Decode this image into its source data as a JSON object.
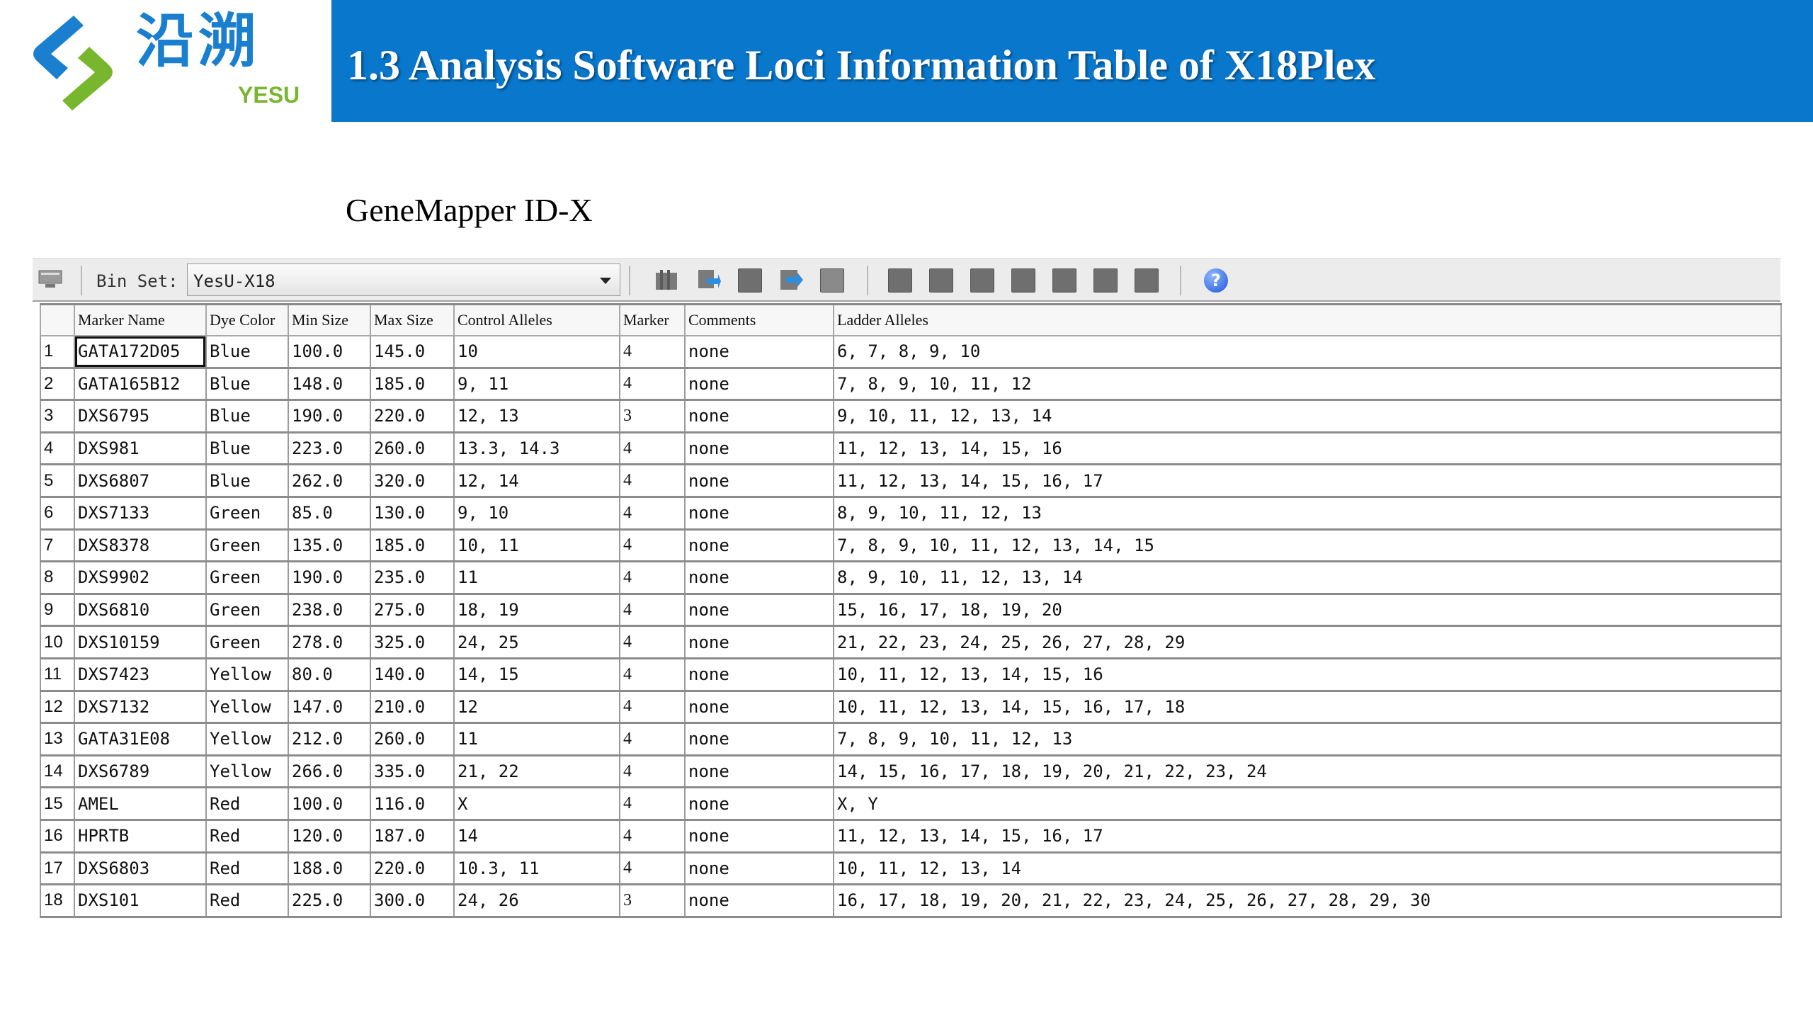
{
  "logo": {
    "cn_text": "沿溯",
    "en_text": "YESU",
    "colors": {
      "blue": "#1a7fce",
      "green": "#78b62e"
    }
  },
  "header": {
    "title": "1.3 Analysis Software Loci Information Table of X18Plex",
    "banner_color": "#0877cc"
  },
  "subtitle": "GeneMapper ID-X",
  "toolbar": {
    "bin_set_label": "Bin Set:",
    "bin_set_value": "YesU-X18",
    "icons": [
      "table-icon",
      "import-icon",
      "grey-square-icon",
      "export-icon",
      "grey-square-icon",
      "grey-square-icon",
      "grey-square-icon",
      "grey-square-icon",
      "grey-square-icon",
      "grey-square-icon",
      "grey-square-icon",
      "grey-square-icon",
      "help-icon"
    ]
  },
  "table": {
    "columns": [
      "",
      "Marker Name",
      "Dye Color",
      "Min Size",
      "Max Size",
      "Control Alleles",
      "Marker",
      "Comments",
      "Ladder Alleles"
    ],
    "rows": [
      [
        "1",
        "GATA172D05",
        "Blue",
        "100.0",
        "145.0",
        "10",
        "4",
        "none",
        "6, 7, 8, 9, 10"
      ],
      [
        "2",
        "GATA165B12",
        "Blue",
        "148.0",
        "185.0",
        "9, 11",
        "4",
        "none",
        "7, 8, 9, 10, 11, 12"
      ],
      [
        "3",
        "DXS6795",
        "Blue",
        "190.0",
        "220.0",
        "12, 13",
        "3",
        "none",
        "9, 10, 11, 12, 13, 14"
      ],
      [
        "4",
        "DXS981",
        "Blue",
        "223.0",
        "260.0",
        "13.3, 14.3",
        "4",
        "none",
        "11, 12, 13, 14, 15, 16"
      ],
      [
        "5",
        "DXS6807",
        "Blue",
        "262.0",
        "320.0",
        "12, 14",
        "4",
        "none",
        "11, 12, 13, 14, 15, 16, 17"
      ],
      [
        "6",
        "DXS7133",
        "Green",
        "85.0",
        "130.0",
        "9, 10",
        "4",
        "none",
        "8, 9, 10, 11, 12, 13"
      ],
      [
        "7",
        "DXS8378",
        "Green",
        "135.0",
        "185.0",
        "10, 11",
        "4",
        "none",
        "7, 8, 9, 10, 11, 12, 13, 14, 15"
      ],
      [
        "8",
        "DXS9902",
        "Green",
        "190.0",
        "235.0",
        "11",
        "4",
        "none",
        "8, 9, 10, 11, 12, 13, 14"
      ],
      [
        "9",
        "DXS6810",
        "Green",
        "238.0",
        "275.0",
        "18, 19",
        "4",
        "none",
        "15, 16, 17, 18, 19, 20"
      ],
      [
        "10",
        "DXS10159",
        "Green",
        "278.0",
        "325.0",
        "24, 25",
        "4",
        "none",
        "21, 22, 23, 24, 25, 26, 27, 28, 29"
      ],
      [
        "11",
        "DXS7423",
        "Yellow",
        "80.0",
        "140.0",
        "14, 15",
        "4",
        "none",
        "10, 11, 12, 13, 14, 15, 16"
      ],
      [
        "12",
        "DXS7132",
        "Yellow",
        "147.0",
        "210.0",
        "12",
        "4",
        "none",
        "10, 11, 12, 13, 14, 15, 16, 17, 18"
      ],
      [
        "13",
        "GATA31E08",
        "Yellow",
        "212.0",
        "260.0",
        "11",
        "4",
        "none",
        "7, 8, 9, 10, 11, 12, 13"
      ],
      [
        "14",
        "DXS6789",
        "Yellow",
        "266.0",
        "335.0",
        "21, 22",
        "4",
        "none",
        "14, 15, 16, 17, 18, 19, 20, 21, 22, 23, 24"
      ],
      [
        "15",
        "AMEL",
        "Red",
        "100.0",
        "116.0",
        "X",
        "4",
        "none",
        "X, Y"
      ],
      [
        "16",
        "HPRTB",
        "Red",
        "120.0",
        "187.0",
        "14",
        "4",
        "none",
        "11, 12, 13, 14, 15, 16, 17"
      ],
      [
        "17",
        "DXS6803",
        "Red",
        "188.0",
        "220.0",
        "10.3, 11",
        "4",
        "none",
        "10, 11, 12, 13, 14"
      ],
      [
        "18",
        "DXS101",
        "Red",
        "225.0",
        "300.0",
        "24, 26",
        "3",
        "none",
        "16, 17, 18, 19, 20, 21, 22, 23, 24, 25, 26, 27, 28, 29, 30"
      ]
    ]
  }
}
